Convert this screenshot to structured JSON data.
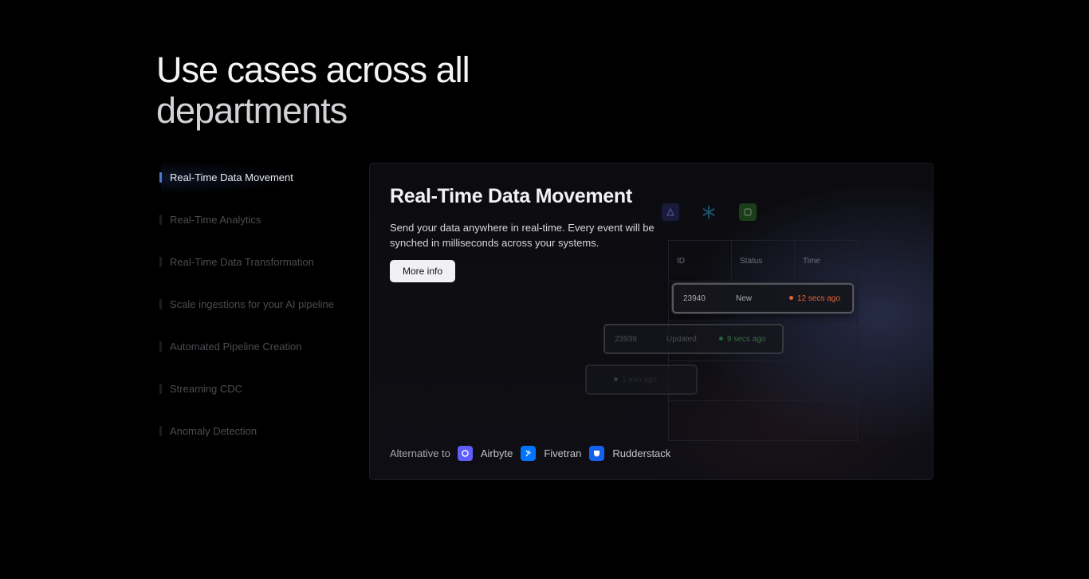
{
  "heading": {
    "line1": "Use cases across all",
    "line2": "departments"
  },
  "nav": {
    "items": [
      {
        "label": "Real-Time Data Movement",
        "active": true
      },
      {
        "label": "Real-Time Analytics"
      },
      {
        "label": "Real-Time Data Transformation"
      },
      {
        "label": "Scale ingestions for your AI pipeline"
      },
      {
        "label": "Automated Pipeline Creation"
      },
      {
        "label": "Streaming CDC"
      },
      {
        "label": "Anomaly Detection"
      }
    ]
  },
  "panel": {
    "title": "Real-Time Data Movement",
    "description": "Send your data anywhere in real-time. Every event will be synched in milliseconds across your systems.",
    "more_button": "More info",
    "alternative_label": "Alternative to",
    "alternatives": [
      {
        "name": "Airbyte",
        "icon": "airbyte-icon",
        "color": "#615eff"
      },
      {
        "name": "Fivetran",
        "icon": "fivetran-icon",
        "color": "#0073ff"
      },
      {
        "name": "Rudderstack",
        "icon": "rudderstack-icon",
        "color": "#1560f0"
      }
    ]
  },
  "table": {
    "headers": [
      "ID",
      "Status",
      "Time"
    ],
    "rows": [
      {
        "id": "23940",
        "status": "New",
        "time": "12 secs ago",
        "color": "#e0653a"
      },
      {
        "id": "23939",
        "status": "Updated",
        "time": "9 secs ago",
        "color": "#3fae5a"
      },
      {
        "id": "",
        "status": "",
        "time": "1 min ago",
        "color": "#4a4a52"
      }
    ]
  },
  "integration_icons": [
    {
      "icon": "connector-icon",
      "color": "#3b3fa8"
    },
    {
      "icon": "snowflake-icon",
      "color": "#29b5e8"
    },
    {
      "icon": "database-icon",
      "color": "#4bbf3a"
    }
  ]
}
